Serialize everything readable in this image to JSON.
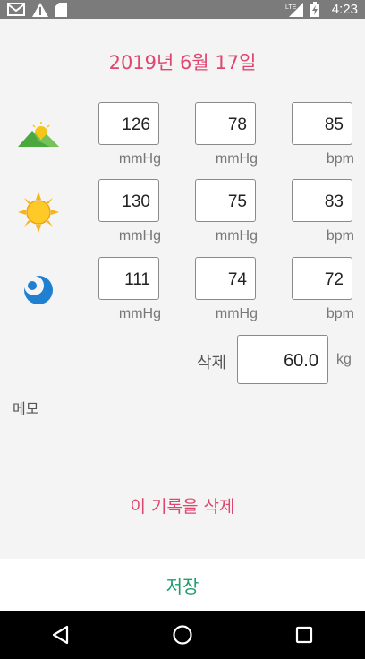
{
  "status_bar": {
    "time": "4:23",
    "icons": [
      "mail-icon",
      "warning-icon",
      "sd-card-icon",
      "lte-signal-icon",
      "battery-charging-icon"
    ]
  },
  "header": {
    "date": "2019년 6월 17일"
  },
  "readings": [
    {
      "period_icon": "morning-mountain-icon",
      "systolic": "126",
      "diastolic": "78",
      "pulse": "85",
      "units": [
        "mmHg",
        "mmHg",
        "bpm"
      ]
    },
    {
      "period_icon": "sun-icon",
      "systolic": "130",
      "diastolic": "75",
      "pulse": "83",
      "units": [
        "mmHg",
        "mmHg",
        "bpm"
      ]
    },
    {
      "period_icon": "moon-icon",
      "systolic": "111",
      "diastolic": "74",
      "pulse": "72",
      "units": [
        "mmHg",
        "mmHg",
        "bpm"
      ]
    }
  ],
  "weight": {
    "label": "삭제",
    "value": "60.0",
    "unit": "kg"
  },
  "memo": {
    "label": "메모"
  },
  "delete_record": {
    "label": "이 기록을 삭제"
  },
  "save_button": {
    "label": "저장"
  },
  "nav": {
    "icons": [
      "back-icon",
      "home-icon",
      "recents-icon"
    ]
  },
  "colors": {
    "accent": "#e0456f",
    "save": "#1f9e6e",
    "status_bar": "#7b7b7b"
  }
}
